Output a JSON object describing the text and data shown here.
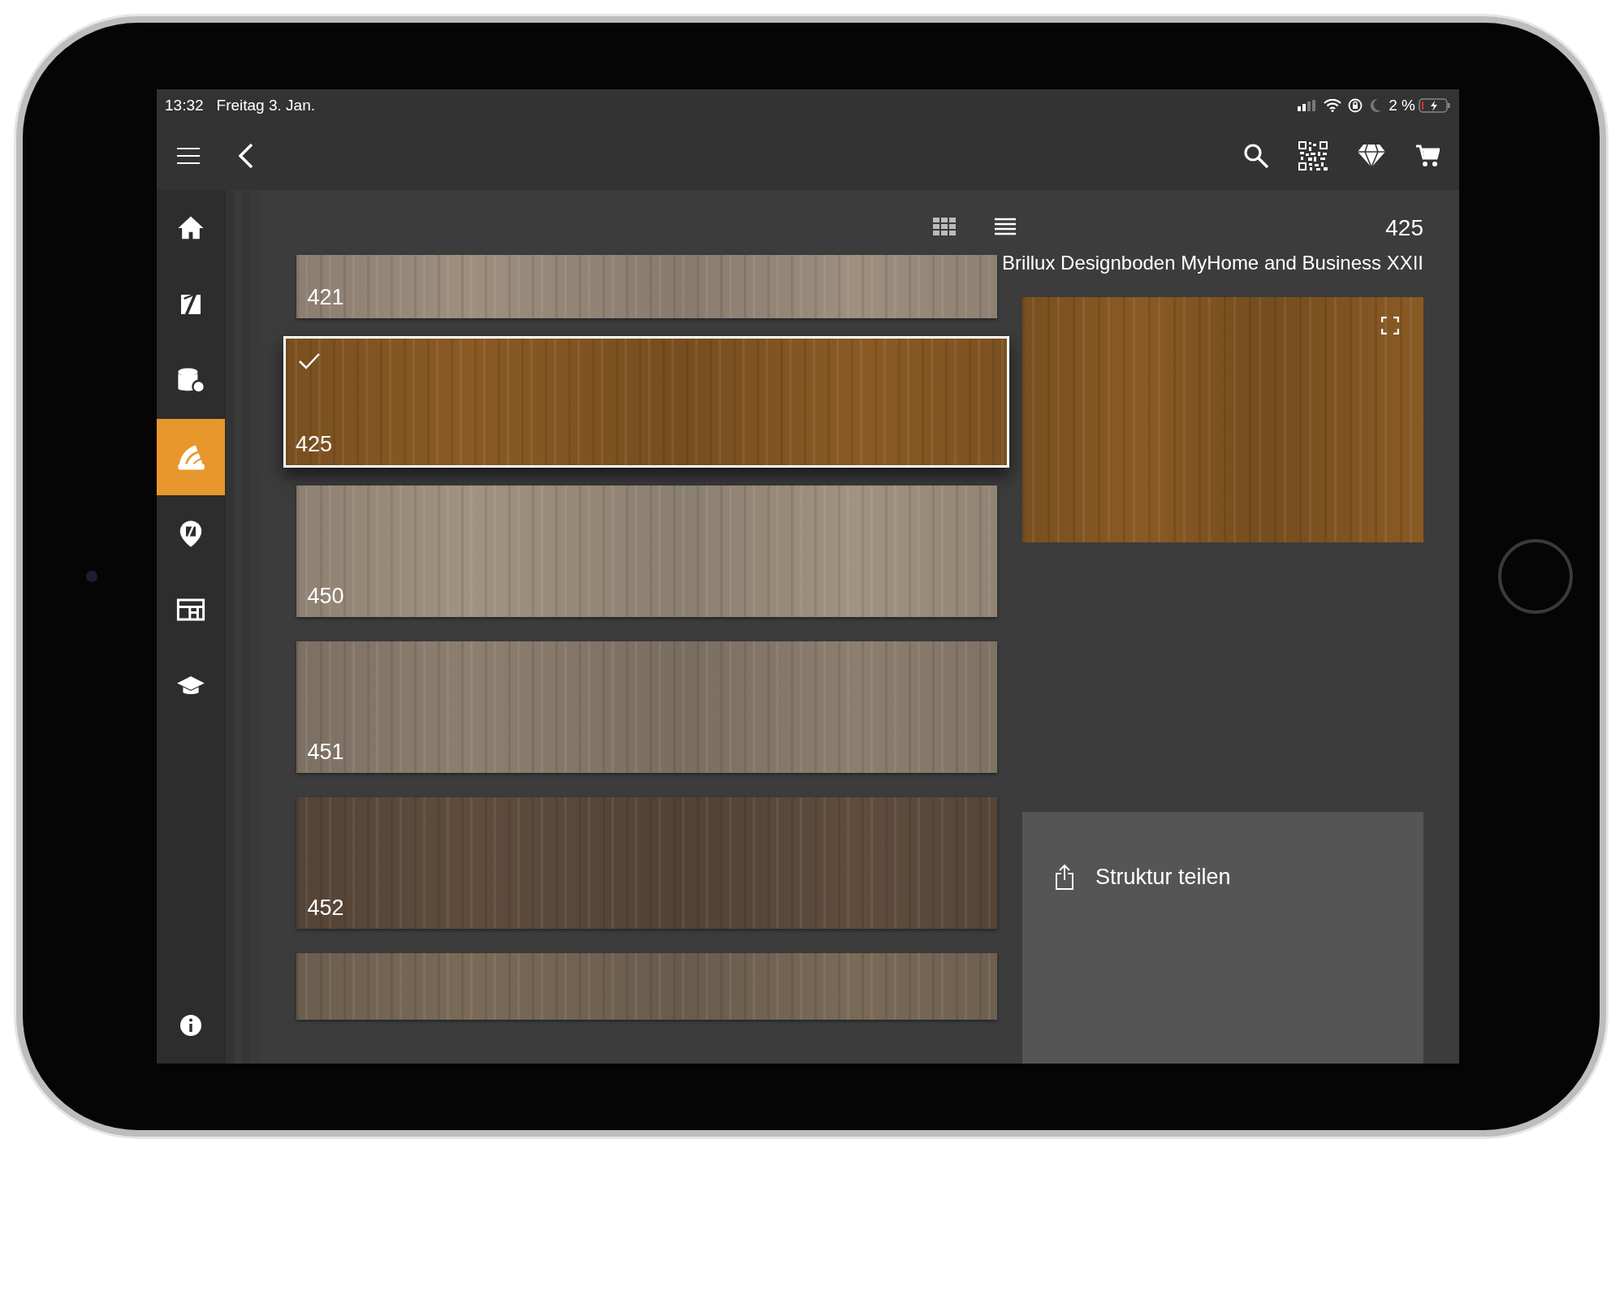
{
  "status_bar": {
    "time": "13:32",
    "date": "Freitag 3. Jan.",
    "battery": "2 %"
  },
  "sidebar": {
    "items": [
      {
        "kind": "home",
        "selected": false
      },
      {
        "kind": "walls",
        "selected": false
      },
      {
        "kind": "paint",
        "selected": false
      },
      {
        "kind": "fandeck",
        "selected": true
      },
      {
        "kind": "location",
        "selected": false
      },
      {
        "kind": "layout",
        "selected": false
      },
      {
        "kind": "training",
        "selected": false
      }
    ]
  },
  "swatches": [
    {
      "label": "421",
      "color": "#9e8f7f",
      "selected": false
    },
    {
      "label": "425",
      "color": "#8a5a24",
      "selected": true
    },
    {
      "label": "450",
      "color": "#a19381",
      "selected": false
    },
    {
      "label": "451",
      "color": "#8d7f70",
      "selected": false
    },
    {
      "label": "452",
      "color": "#5f4c3d",
      "selected": false
    },
    {
      "color": "#7a6a58",
      "selected": false
    }
  ],
  "detail": {
    "code": "425",
    "name": "Brillux Designboden MyHome and Business XXII",
    "action": "Struktur teilen"
  }
}
